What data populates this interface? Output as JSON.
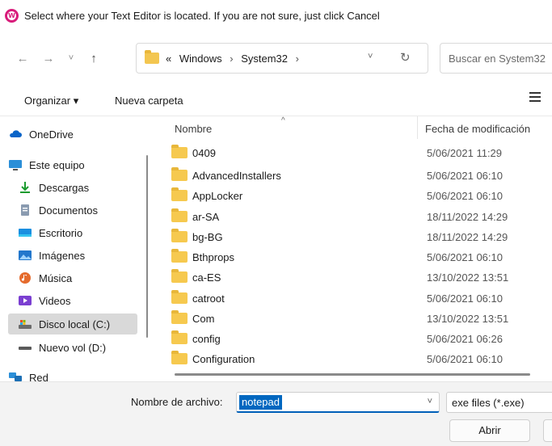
{
  "window": {
    "title": "Select where your Text Editor is located. If you are not sure, just click Cancel",
    "icon_glyph": "W"
  },
  "nav": {
    "back_icon": "←",
    "forward_icon": "→",
    "recent_icon": "˅",
    "up_icon": "↑",
    "breadcrumb_overflow": "«",
    "breadcrumbs": [
      "Windows",
      "System32"
    ],
    "separator": "›",
    "dropdown_icon": "˅",
    "refresh_icon": "↻",
    "search_placeholder": "Buscar en System32"
  },
  "toolbar": {
    "organize_label": "Organizar ▾",
    "new_folder_label": "Nueva carpeta"
  },
  "sidebar": {
    "items": [
      {
        "label": "OneDrive",
        "icon": "cloud-icon"
      },
      {
        "label": "Este equipo",
        "icon": "computer-icon"
      },
      {
        "label": "Descargas",
        "icon": "download-icon"
      },
      {
        "label": "Documentos",
        "icon": "document-icon"
      },
      {
        "label": "Escritorio",
        "icon": "desktop-icon"
      },
      {
        "label": "Imágenes",
        "icon": "images-icon"
      },
      {
        "label": "Música",
        "icon": "music-icon"
      },
      {
        "label": "Videos",
        "icon": "video-icon"
      },
      {
        "label": "Disco local (C:)",
        "icon": "drive-icon"
      },
      {
        "label": "Nuevo vol (D:)",
        "icon": "drive-icon"
      },
      {
        "label": "Red",
        "icon": "network-icon"
      }
    ],
    "selected_index": 8
  },
  "filelist": {
    "columns": {
      "name": "Nombre",
      "date": "Fecha de modificación"
    },
    "sort_caret": "^",
    "rows": [
      {
        "name": "0409",
        "date": "5/06/2021 11:29"
      },
      {
        "name": "AdvancedInstallers",
        "date": "5/06/2021 06:10"
      },
      {
        "name": "AppLocker",
        "date": "5/06/2021 06:10"
      },
      {
        "name": "ar-SA",
        "date": "18/11/2022 14:29"
      },
      {
        "name": "bg-BG",
        "date": "18/11/2022 14:29"
      },
      {
        "name": "Bthprops",
        "date": "5/06/2021 06:10"
      },
      {
        "name": "ca-ES",
        "date": "13/10/2022 13:51"
      },
      {
        "name": "catroot",
        "date": "5/06/2021 06:10"
      },
      {
        "name": "Com",
        "date": "13/10/2022 13:51"
      },
      {
        "name": "config",
        "date": "5/06/2021 06:26"
      },
      {
        "name": "Configuration",
        "date": "5/06/2021 06:10"
      }
    ]
  },
  "footer": {
    "filename_label": "Nombre de archivo:",
    "filename_value": "notepad",
    "filetype_value": "exe files (*.exe)",
    "open_label": "Abrir"
  },
  "colors": {
    "accent": "#0067c0",
    "folder": "#f6c94f",
    "selected_bg": "#d9d9d9"
  }
}
